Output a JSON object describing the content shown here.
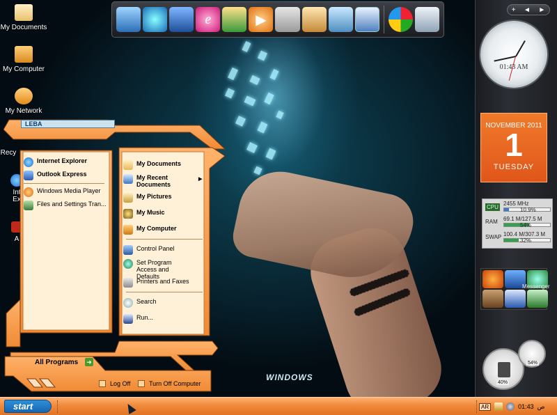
{
  "desktop": {
    "icons": [
      {
        "label": "My Documents"
      },
      {
        "label": "My Computer"
      },
      {
        "label": "My Network"
      },
      {
        "label": "Recy"
      },
      {
        "label": "Int Ex"
      },
      {
        "label": "A"
      }
    ],
    "wallpaper_text": "WINDOWS"
  },
  "dock": {
    "icons": [
      "monitor-icon",
      "browser-icon",
      "book-icon",
      "internet-explorer-icon",
      "photo-icon",
      "media-player-icon",
      "calculator-icon",
      "paint-icon",
      "notes-icon",
      "tools-icon",
      "windows-logo-icon",
      "recycle-bin-icon"
    ]
  },
  "sidebar": {
    "controls": {
      "add": "+",
      "prev": "◄",
      "next": "►"
    },
    "clock": {
      "time": "01:43 AM"
    },
    "calendar": {
      "month_year": "NOVEMBER 2011",
      "day": "1",
      "weekday": "TUESDAY"
    },
    "meter": {
      "rows": [
        {
          "key": "CPU",
          "value": "2455 MHz",
          "percent_label": "10.9%",
          "fraction": 0.109
        },
        {
          "key": "RAM",
          "value": "69.1 M/127.5 M",
          "percent_label": "54%",
          "fraction": 0.54
        },
        {
          "key": "SWAP",
          "value": "100.4 M/307.3 M",
          "percent_label": "32%",
          "fraction": 0.32
        }
      ]
    },
    "apps_label": "Messenger",
    "gauges": [
      {
        "label": "40%"
      },
      {
        "label": "54%"
      }
    ]
  },
  "start_menu": {
    "user": "LEBA",
    "left_items": [
      {
        "label": "Internet Explorer",
        "bold": true,
        "icon": "internet-explorer-icon"
      },
      {
        "label": "Outlook Express",
        "bold": true,
        "icon": "outlook-icon"
      },
      {
        "label": "Windows Media Player",
        "bold": false,
        "icon": "media-player-icon"
      },
      {
        "label": "Files and Settings Tran...",
        "bold": false,
        "icon": "transfer-wizard-icon"
      }
    ],
    "right_items": [
      {
        "label": "My Documents",
        "bold": true
      },
      {
        "label": "My Recent Documents",
        "bold": true
      },
      {
        "label": "My Pictures",
        "bold": true
      },
      {
        "label": "My Music",
        "bold": true
      },
      {
        "label": "My Computer",
        "bold": true
      },
      {
        "label": "Control Panel",
        "bold": false
      },
      {
        "label": "Set Program Access and Defaults",
        "bold": false
      },
      {
        "label": "Printers and Faxes",
        "bold": false
      },
      {
        "label": "Search",
        "bold": false
      },
      {
        "label": "Run...",
        "bold": false
      }
    ],
    "all_programs": "All Programs",
    "log_off": "Log Off",
    "turn_off": "Turn Off Computer"
  },
  "taskbar": {
    "start_label": "start",
    "tray": {
      "lang": "AR",
      "time": "01:43",
      "ampm": "ص"
    }
  }
}
